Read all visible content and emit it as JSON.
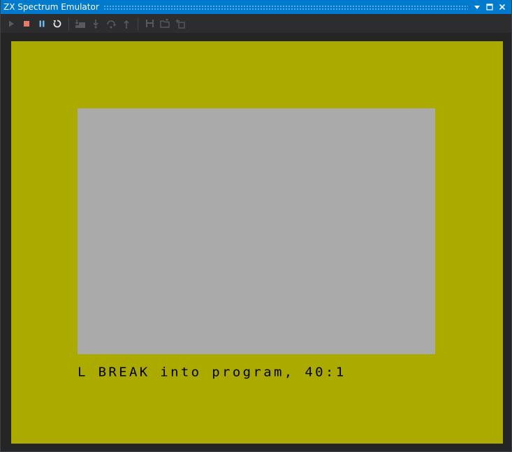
{
  "window": {
    "title": "ZX Spectrum Emulator",
    "buttons": {
      "dropdown": "dropdown-icon",
      "maximize": "maximize-icon",
      "close": "close-icon"
    }
  },
  "toolbar": {
    "items": [
      {
        "name": "start-button",
        "icon": "play-icon",
        "enabled": false,
        "color": "#5a5a5e"
      },
      {
        "name": "stop-button",
        "icon": "stop-icon",
        "enabled": true,
        "color": "#e77b6a"
      },
      {
        "name": "pause-button",
        "icon": "pause-icon",
        "enabled": true,
        "color": "#6fb8f0"
      },
      {
        "name": "restart-button",
        "icon": "restart-icon",
        "enabled": true,
        "color": "#e6e6e6"
      },
      {
        "name": "step-into-button",
        "icon": "step-into-icon",
        "enabled": false,
        "color": "#5a5a5e"
      },
      {
        "name": "step-over-button",
        "icon": "step-over-icon",
        "enabled": false,
        "color": "#5a5a5e"
      },
      {
        "name": "step-out-button",
        "icon": "step-out-icon",
        "enabled": false,
        "color": "#5a5a5e"
      },
      {
        "name": "save-state-button",
        "icon": "save-icon",
        "enabled": false,
        "color": "#5a5a5e"
      },
      {
        "name": "load-state-button",
        "icon": "open-folder-icon",
        "enabled": false,
        "color": "#5a5a5e"
      },
      {
        "name": "add-vm-button",
        "icon": "add-icon",
        "enabled": false,
        "color": "#5a5a5e"
      }
    ]
  },
  "emulator": {
    "border_color": "#aaaa00",
    "paper_color": "#aaaaaa",
    "ink_color": "#000000",
    "status_message": "L BREAK into program, 40:1"
  }
}
